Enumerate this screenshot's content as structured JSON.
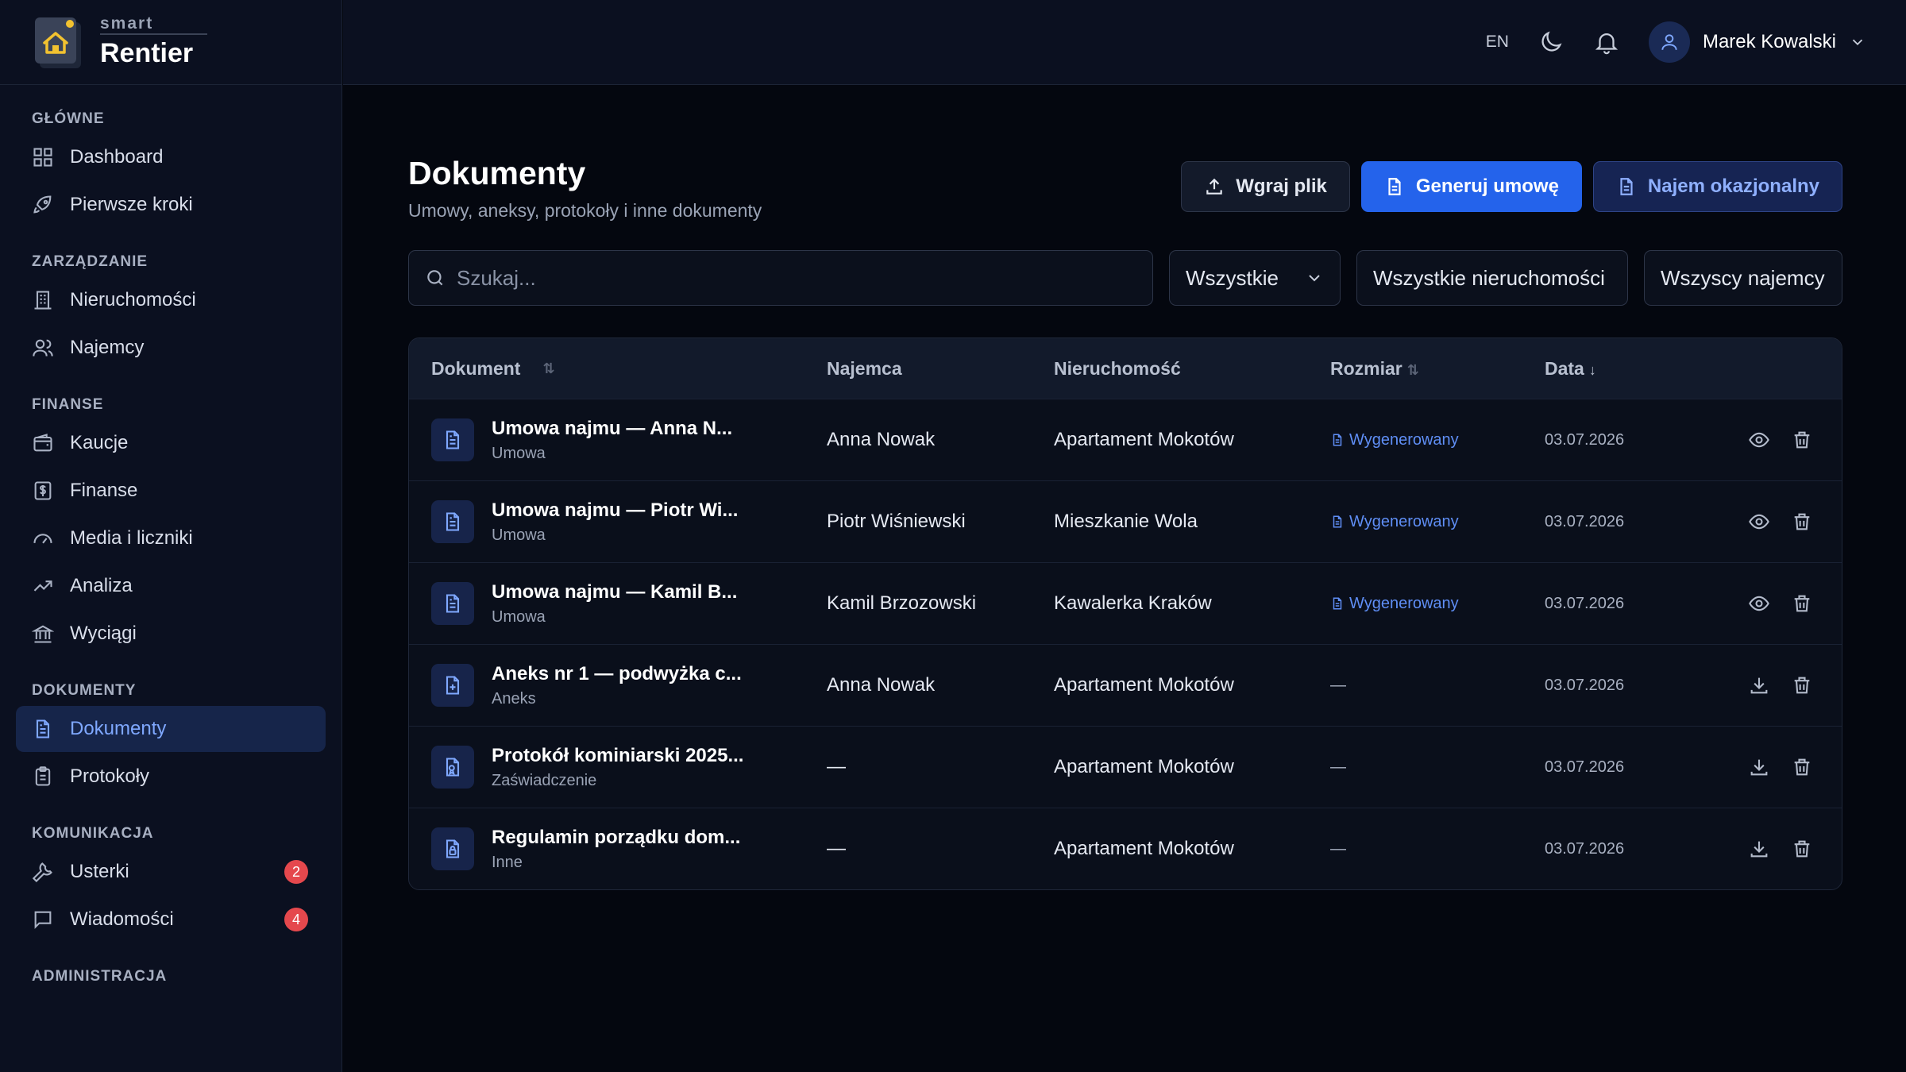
{
  "brand": {
    "small": "smart",
    "big": "Rentier",
    "colors": {
      "house": "#f2c230",
      "bg": "#2b3345"
    }
  },
  "header": {
    "lang": "EN",
    "user_name": "Marek Kowalski"
  },
  "sidebar": {
    "sections": [
      {
        "title": "GŁÓWNE",
        "items": [
          {
            "label": "Dashboard",
            "icon": "grid-icon"
          },
          {
            "label": "Pierwsze kroki",
            "icon": "rocket-icon"
          }
        ]
      },
      {
        "title": "ZARZĄDZANIE",
        "items": [
          {
            "label": "Nieruchomości",
            "icon": "building-icon"
          },
          {
            "label": "Najemcy",
            "icon": "users-icon"
          }
        ]
      },
      {
        "title": "FINANSE",
        "items": [
          {
            "label": "Kaucje",
            "icon": "wallet-icon"
          },
          {
            "label": "Finanse",
            "icon": "dollar-icon"
          },
          {
            "label": "Media i liczniki",
            "icon": "gauge-icon"
          },
          {
            "label": "Analiza",
            "icon": "trend-icon"
          },
          {
            "label": "Wyciągi",
            "icon": "bank-icon"
          }
        ]
      },
      {
        "title": "DOKUMENTY",
        "items": [
          {
            "label": "Dokumenty",
            "icon": "document-icon",
            "active": true
          },
          {
            "label": "Protokoły",
            "icon": "clipboard-icon"
          }
        ]
      },
      {
        "title": "KOMUNIKACJA",
        "items": [
          {
            "label": "Usterki",
            "icon": "wrench-icon",
            "badge": "2"
          },
          {
            "label": "Wiadomości",
            "icon": "message-icon",
            "badge": "4"
          }
        ]
      },
      {
        "title": "ADMINISTRACJA",
        "items": []
      }
    ]
  },
  "page": {
    "title": "Dokumenty",
    "subtitle": "Umowy, aneksy, protokoły i inne dokumenty",
    "buttons": {
      "upload": "Wgraj plik",
      "generate": "Generuj umowę",
      "occasional": "Najem okazjonalny"
    }
  },
  "filters": {
    "search_placeholder": "Szukaj...",
    "type": "Wszystkie",
    "property": "Wszystkie nieruchomości",
    "tenant": "Wszyscy najemcy"
  },
  "table": {
    "headers": {
      "document": "Dokument",
      "tenant": "Najemca",
      "property": "Nieruchomość",
      "size": "Rozmiar",
      "date": "Data"
    },
    "sort_icons": {
      "both": "⇅",
      "down": "↓"
    },
    "rows": [
      {
        "title": "Umowa najmu — Anna N...",
        "type": "Umowa",
        "tenant": "Anna Nowak",
        "property": "Apartament Mokotów",
        "size": "Wygenerowany",
        "date": "03.07.2026",
        "icon": "file-text-icon",
        "action": "view"
      },
      {
        "title": "Umowa najmu — Piotr Wi...",
        "type": "Umowa",
        "tenant": "Piotr Wiśniewski",
        "property": "Mieszkanie Wola",
        "size": "Wygenerowany",
        "date": "03.07.2026",
        "icon": "file-text-icon",
        "action": "view"
      },
      {
        "title": "Umowa najmu — Kamil B...",
        "type": "Umowa",
        "tenant": "Kamil Brzozowski",
        "property": "Kawalerka Kraków",
        "size": "Wygenerowany",
        "date": "03.07.2026",
        "icon": "file-text-icon",
        "action": "view"
      },
      {
        "title": "Aneks nr 1 — podwyżka c...",
        "type": "Aneks",
        "tenant": "Anna Nowak",
        "property": "Apartament Mokotów",
        "size": "—",
        "date": "03.07.2026",
        "icon": "file-plus-icon",
        "action": "download"
      },
      {
        "title": "Protokół kominiarski 2025...",
        "type": "Zaświadczenie",
        "tenant": "—",
        "property": "Apartament Mokotów",
        "size": "—",
        "date": "03.07.2026",
        "icon": "file-badge-icon",
        "action": "download"
      },
      {
        "title": "Regulamin porządku dom...",
        "type": "Inne",
        "tenant": "—",
        "property": "Apartament Mokotów",
        "size": "—",
        "date": "03.07.2026",
        "icon": "file-lock-icon",
        "action": "download"
      }
    ]
  }
}
